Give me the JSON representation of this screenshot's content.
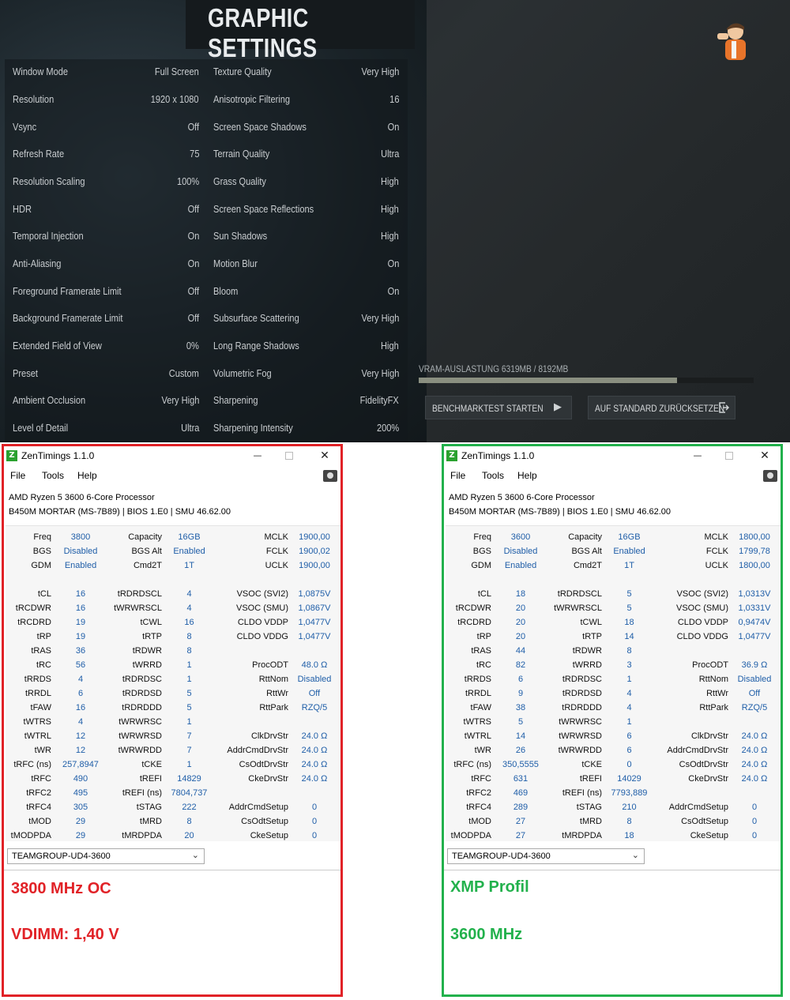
{
  "game": {
    "title": "GRAPHIC SETTINGS",
    "left_settings": [
      {
        "label": "Window Mode",
        "value": "Full Screen"
      },
      {
        "label": "Resolution",
        "value": "1920 x 1080"
      },
      {
        "label": "Vsync",
        "value": "Off"
      },
      {
        "label": "Refresh Rate",
        "value": "75"
      },
      {
        "label": "Resolution Scaling",
        "value": "100%"
      },
      {
        "label": "HDR",
        "value": "Off"
      },
      {
        "label": "Temporal Injection",
        "value": "On"
      },
      {
        "label": "Anti-Aliasing",
        "value": "On"
      },
      {
        "label": "Foreground Framerate Limit",
        "value": "Off"
      },
      {
        "label": "Background Framerate Limit",
        "value": "Off"
      },
      {
        "label": "Extended Field of View",
        "value": "0%"
      },
      {
        "label": "Preset",
        "value": "Custom"
      },
      {
        "label": "Ambient Occlusion",
        "value": "Very High"
      },
      {
        "label": "Level of Detail",
        "value": "Ultra"
      }
    ],
    "right_settings": [
      {
        "label": "Texture Quality",
        "value": "Very High"
      },
      {
        "label": "Anisotropic Filtering",
        "value": "16"
      },
      {
        "label": "Screen Space Shadows",
        "value": "On"
      },
      {
        "label": "Terrain Quality",
        "value": "Ultra"
      },
      {
        "label": "Grass Quality",
        "value": "High"
      },
      {
        "label": "Screen Space Reflections",
        "value": "High"
      },
      {
        "label": "Sun Shadows",
        "value": "High"
      },
      {
        "label": "Motion Blur",
        "value": "On"
      },
      {
        "label": "Bloom",
        "value": "On"
      },
      {
        "label": "Subsurface Scattering",
        "value": "Very High"
      },
      {
        "label": "Long Range Shadows",
        "value": "High"
      },
      {
        "label": "Volumetric Fog",
        "value": "Very High"
      },
      {
        "label": "Sharpening",
        "value": "FidelityFX"
      },
      {
        "label": "Sharpening Intensity",
        "value": "200%"
      }
    ],
    "vram_label": "VRAM-AUSLASTUNG 6319MB / 8192MB",
    "vram_fraction": 0.7714,
    "benchmark_button": "BENCHMARKTEST STARTEN",
    "reset_button": "AUF STANDARD ZURÜCKSETZEN"
  },
  "windows": [
    {
      "title": "ZenTimings 1.1.0",
      "menu": [
        "File",
        "Tools",
        "Help"
      ],
      "cpu": "AMD Ryzen 5 3600 6-Core Processor",
      "board": "B450M MORTAR (MS-7B89) | BIOS 1.E0 | SMU 46.62.00",
      "rows": [
        [
          "Freq",
          "3800",
          "Capacity",
          "16GB",
          "MCLK",
          "1900,00"
        ],
        [
          "BGS",
          "Disabled",
          "BGS Alt",
          "Enabled",
          "FCLK",
          "1900,02"
        ],
        [
          "GDM",
          "Enabled",
          "Cmd2T",
          "1T",
          "UCLK",
          "1900,00"
        ],
        [
          "",
          "",
          "",
          "",
          "",
          ""
        ],
        [
          "tCL",
          "16",
          "tRDRDSCL",
          "4",
          "VSOC (SVI2)",
          "1,0875V"
        ],
        [
          "tRCDWR",
          "16",
          "tWRWRSCL",
          "4",
          "VSOC (SMU)",
          "1,0867V"
        ],
        [
          "tRCDRD",
          "19",
          "tCWL",
          "16",
          "CLDO VDDP",
          "1,0477V"
        ],
        [
          "tRP",
          "19",
          "tRTP",
          "8",
          "CLDO VDDG",
          "1,0477V"
        ],
        [
          "tRAS",
          "36",
          "tRDWR",
          "8",
          "",
          ""
        ],
        [
          "tRC",
          "56",
          "tWRRD",
          "1",
          "ProcODT",
          "48.0 Ω"
        ],
        [
          "tRRDS",
          "4",
          "tRDRDSC",
          "1",
          "RttNom",
          "Disabled"
        ],
        [
          "tRRDL",
          "6",
          "tRDRDSD",
          "5",
          "RttWr",
          "Off"
        ],
        [
          "tFAW",
          "16",
          "tRDRDDD",
          "5",
          "RttPark",
          "RZQ/5"
        ],
        [
          "tWTRS",
          "4",
          "tWRWRSC",
          "1",
          "",
          ""
        ],
        [
          "tWTRL",
          "12",
          "tWRWRSD",
          "7",
          "ClkDrvStr",
          "24.0 Ω"
        ],
        [
          "tWR",
          "12",
          "tWRWRDD",
          "7",
          "AddrCmdDrvStr",
          "24.0 Ω"
        ],
        [
          "tRFC (ns)",
          "257,8947",
          "tCKE",
          "1",
          "CsOdtDrvStr",
          "24.0 Ω"
        ],
        [
          "tRFC",
          "490",
          "tREFI",
          "14829",
          "CkeDrvStr",
          "24.0 Ω"
        ],
        [
          "tRFC2",
          "495",
          "tREFI (ns)",
          "7804,737",
          "",
          ""
        ],
        [
          "tRFC4",
          "305",
          "tSTAG",
          "222",
          "AddrCmdSetup",
          "0"
        ],
        [
          "tMOD",
          "29",
          "tMRD",
          "8",
          "CsOdtSetup",
          "0"
        ],
        [
          "tMODPDA",
          "29",
          "tMRDPDA",
          "20",
          "CkeSetup",
          "0"
        ]
      ],
      "module": "TEAMGROUP-UD4-3600",
      "note1": "3800 MHz OC",
      "note2": "VDIMM: 1,40 V"
    },
    {
      "title": "ZenTimings 1.1.0",
      "menu": [
        "File",
        "Tools",
        "Help"
      ],
      "cpu": "AMD Ryzen 5 3600 6-Core Processor",
      "board": "B450M MORTAR (MS-7B89) | BIOS 1.E0 | SMU 46.62.00",
      "rows": [
        [
          "Freq",
          "3600",
          "Capacity",
          "16GB",
          "MCLK",
          "1800,00"
        ],
        [
          "BGS",
          "Disabled",
          "BGS Alt",
          "Enabled",
          "FCLK",
          "1799,78"
        ],
        [
          "GDM",
          "Enabled",
          "Cmd2T",
          "1T",
          "UCLK",
          "1800,00"
        ],
        [
          "",
          "",
          "",
          "",
          "",
          ""
        ],
        [
          "tCL",
          "18",
          "tRDRDSCL",
          "5",
          "VSOC (SVI2)",
          "1,0313V"
        ],
        [
          "tRCDWR",
          "20",
          "tWRWRSCL",
          "5",
          "VSOC (SMU)",
          "1,0331V"
        ],
        [
          "tRCDRD",
          "20",
          "tCWL",
          "18",
          "CLDO VDDP",
          "0,9474V"
        ],
        [
          "tRP",
          "20",
          "tRTP",
          "14",
          "CLDO VDDG",
          "1,0477V"
        ],
        [
          "tRAS",
          "44",
          "tRDWR",
          "8",
          "",
          ""
        ],
        [
          "tRC",
          "82",
          "tWRRD",
          "3",
          "ProcODT",
          "36.9 Ω"
        ],
        [
          "tRRDS",
          "6",
          "tRDRDSC",
          "1",
          "RttNom",
          "Disabled"
        ],
        [
          "tRRDL",
          "9",
          "tRDRDSD",
          "4",
          "RttWr",
          "Off"
        ],
        [
          "tFAW",
          "38",
          "tRDRDDD",
          "4",
          "RttPark",
          "RZQ/5"
        ],
        [
          "tWTRS",
          "5",
          "tWRWRSC",
          "1",
          "",
          ""
        ],
        [
          "tWTRL",
          "14",
          "tWRWRSD",
          "6",
          "ClkDrvStr",
          "24.0 Ω"
        ],
        [
          "tWR",
          "26",
          "tWRWRDD",
          "6",
          "AddrCmdDrvStr",
          "24.0 Ω"
        ],
        [
          "tRFC (ns)",
          "350,5555",
          "tCKE",
          "0",
          "CsOdtDrvStr",
          "24.0 Ω"
        ],
        [
          "tRFC",
          "631",
          "tREFI",
          "14029",
          "CkeDrvStr",
          "24.0 Ω"
        ],
        [
          "tRFC2",
          "469",
          "tREFI (ns)",
          "7793,889",
          "",
          ""
        ],
        [
          "tRFC4",
          "289",
          "tSTAG",
          "210",
          "AddrCmdSetup",
          "0"
        ],
        [
          "tMOD",
          "27",
          "tMRD",
          "8",
          "CsOdtSetup",
          "0"
        ],
        [
          "tMODPDA",
          "27",
          "tMRDPDA",
          "18",
          "CkeSetup",
          "0"
        ]
      ],
      "module": "TEAMGROUP-UD4-3600",
      "note1": "XMP Profil",
      "note2": "3600 MHz"
    }
  ]
}
